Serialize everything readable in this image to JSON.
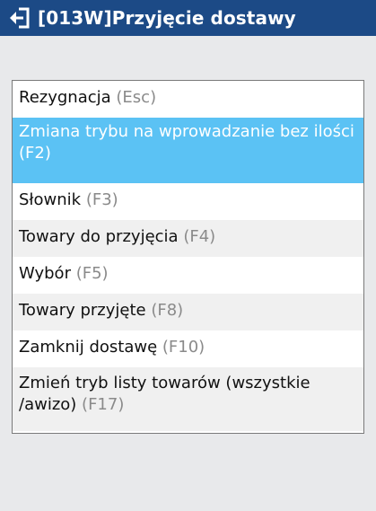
{
  "header": {
    "title": "[013W]Przyjęcie dostawy",
    "back_icon": "return-arrow-icon"
  },
  "colors": {
    "header_bg": "#1c4a86",
    "selected_bg": "#5bc2f4",
    "alt_row_bg": "#f0f0f0",
    "shortcut_text": "#8a8a8a"
  },
  "menu": {
    "items": [
      {
        "label": "Rezygnacja",
        "shortcut": "(Esc)"
      },
      {
        "label": "Zmiana trybu na wprowadzanie bez ilości",
        "shortcut": "(F2)",
        "selected": true
      },
      {
        "label": "Słownik",
        "shortcut": "(F3)"
      },
      {
        "label": "Towary do przyjęcia",
        "shortcut": "(F4)"
      },
      {
        "label": "Wybór",
        "shortcut": "(F5)"
      },
      {
        "label": "Towary przyjęte",
        "shortcut": "(F8)"
      },
      {
        "label": "Zamknij dostawę",
        "shortcut": "(F10)"
      },
      {
        "label": "Zmień tryb listy towarów (wszystkie /awizo)",
        "shortcut": "(F17)"
      }
    ]
  }
}
